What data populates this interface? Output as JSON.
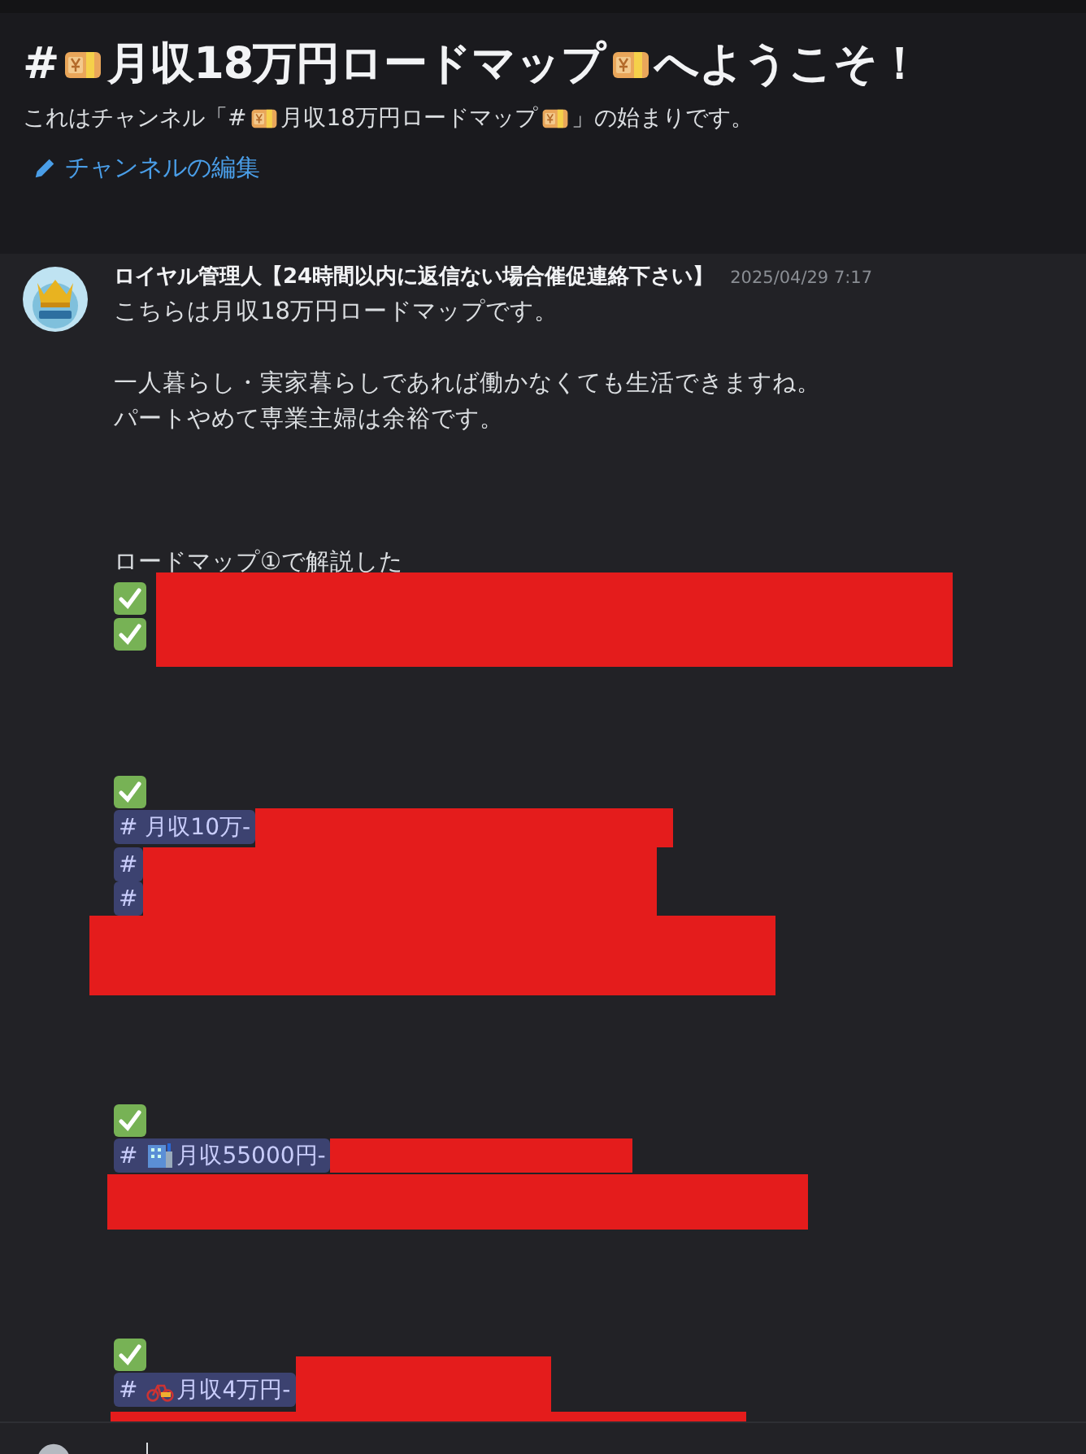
{
  "channel_header": {
    "title": [
      {
        "kind": "text",
        "text": "#"
      },
      {
        "kind": "money"
      },
      {
        "kind": "text",
        "text": "月収18万円ロードマップ"
      },
      {
        "kind": "money"
      },
      {
        "kind": "text",
        "text": "へようこそ！"
      }
    ],
    "subtitle": [
      {
        "kind": "text",
        "text": "これはチャンネル「#"
      },
      {
        "kind": "money"
      },
      {
        "kind": "text",
        "text": "月収18万円ロードマップ"
      },
      {
        "kind": "money"
      },
      {
        "kind": "text",
        "text": "」の始まりです。"
      }
    ],
    "edit_link": "チャンネルの編集"
  },
  "message": {
    "author": "ロイヤル管理人【24時間以内に返信ない場合催促連絡下さい】",
    "timestamp": "2025/04/29 7:17",
    "content": [
      {
        "kind": "text",
        "text": "こちらは月収18万円ロードマップです。"
      },
      {
        "kind": "blank"
      },
      {
        "kind": "text",
        "text": "一人暮らし・実家暮らしであれば働かなくても生活できますね。"
      },
      {
        "kind": "text",
        "text": "パートやめて専業主婦は余裕です。"
      },
      {
        "kind": "blank"
      },
      {
        "kind": "blank"
      },
      {
        "kind": "blank"
      },
      {
        "kind": "text",
        "text": "ロードマップ①で解説した"
      },
      {
        "kind": "checks"
      },
      {
        "kind": "blank"
      },
      {
        "kind": "blank"
      },
      {
        "kind": "blank"
      },
      {
        "kind": "check"
      },
      {
        "kind": "mentions",
        "mentions": [
          {
            "text": "# 月収10万-"
          }
        ]
      },
      {
        "kind": "mentions",
        "mentions": [
          {
            "text": "#"
          },
          {
            "text": "#"
          }
        ]
      },
      {
        "kind": "redaction"
      },
      {
        "kind": "blank"
      },
      {
        "kind": "blank"
      },
      {
        "kind": "blank"
      },
      {
        "kind": "check"
      },
      {
        "kind": "mentions",
        "mentions": [
          {
            "text": "#",
            "label": "月収55000円-"
          }
        ]
      },
      {
        "kind": "redaction"
      },
      {
        "kind": "blank"
      },
      {
        "kind": "blank"
      },
      {
        "kind": "blank"
      },
      {
        "kind": "check"
      },
      {
        "kind": "mentions",
        "mentions": [
          {
            "text": "#",
            "label": "月収4万円-"
          }
        ]
      },
      {
        "kind": "redaction"
      }
    ]
  }
}
